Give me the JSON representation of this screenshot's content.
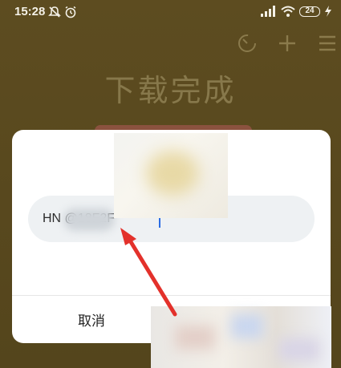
{
  "status_bar": {
    "time": "15:28",
    "battery": "24",
    "icons": [
      "mute-icon",
      "alarm-icon",
      "signal-icon",
      "wifi-icon",
      "battery-icon",
      "charging-icon"
    ]
  },
  "toolbar": {
    "icons": [
      "speed-icon",
      "plus-icon",
      "menu-icon"
    ]
  },
  "page": {
    "title": "下载完成"
  },
  "dialog": {
    "input_value": "HN      @18F2F",
    "cancel_label": "取消"
  },
  "annotation": {
    "arrow_color": "#e3312b"
  }
}
